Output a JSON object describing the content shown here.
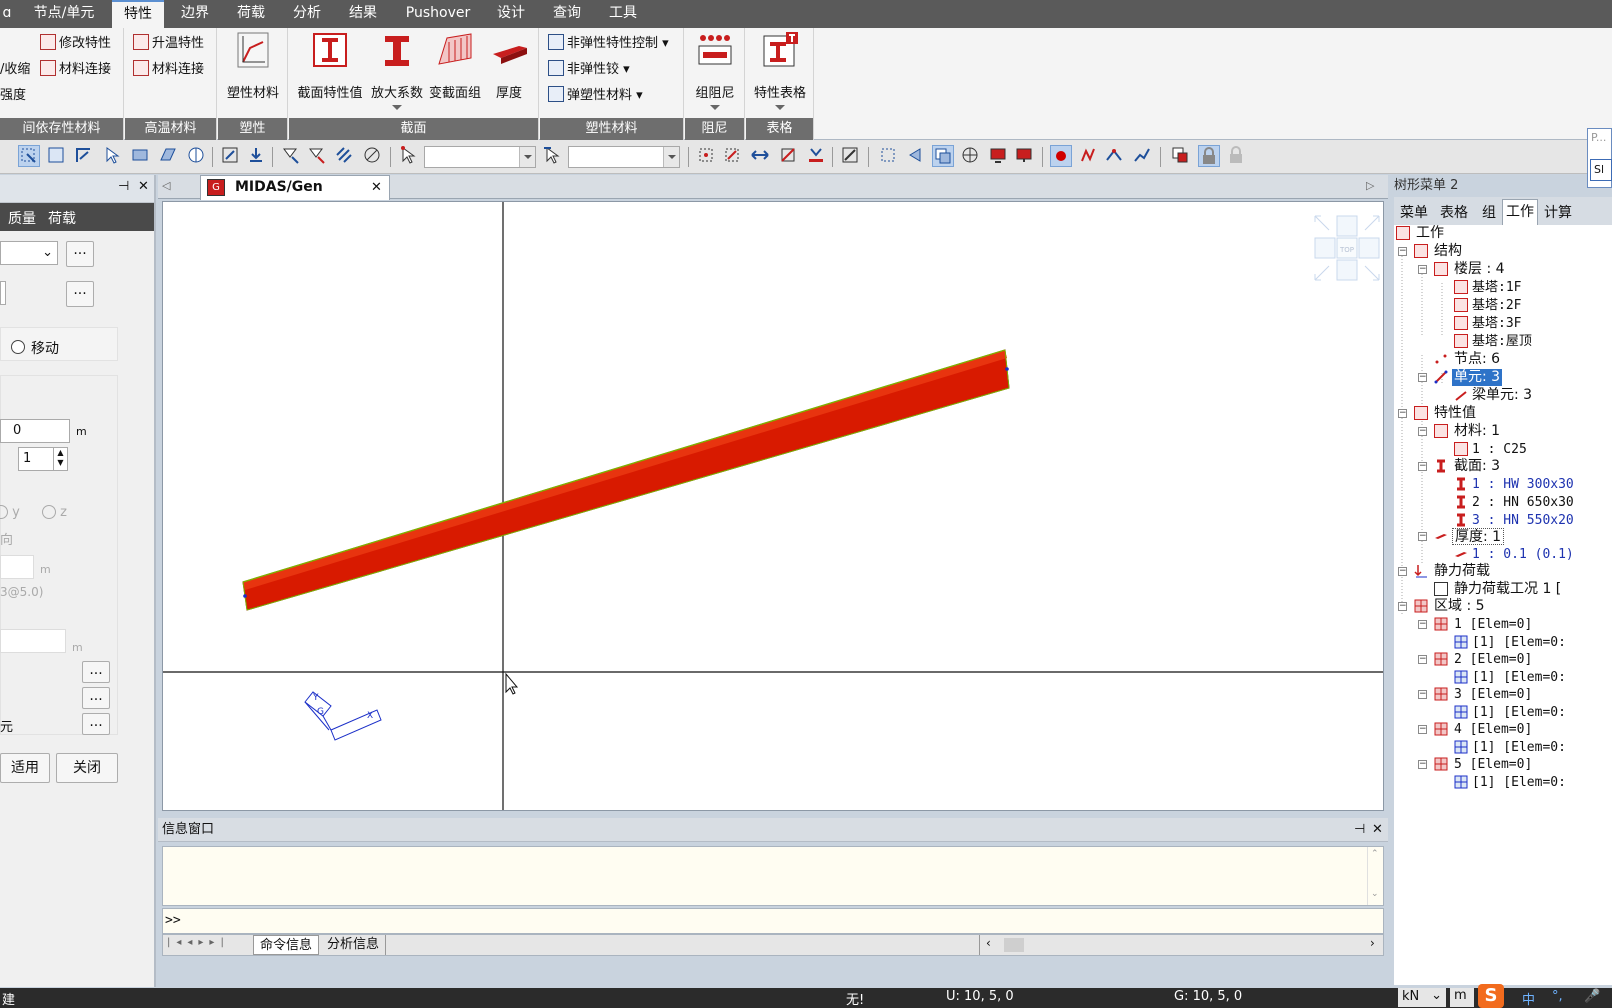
{
  "menu": {
    "tabs": [
      "节点/单元",
      "特性",
      "边界",
      "荷载",
      "分析",
      "结果",
      "Pushover",
      "设计",
      "查询",
      "工具"
    ],
    "active": "特性",
    "left_cut": "ɑ"
  },
  "ribbon": {
    "g1": {
      "title": "间依存性材料",
      "b1": "修改特性",
      "b2": "/收缩",
      "b3": "材料连接",
      "b4": "强度"
    },
    "g2": {
      "title": "高温材料",
      "b1": "升温特性",
      "b2": "材料连接"
    },
    "g3": {
      "title": "塑性",
      "b1": "塑性材料"
    },
    "g4": {
      "title": "截面",
      "b1": "截面特性值",
      "b2": "放大系数",
      "b3": "变截面组",
      "b4": "厚度"
    },
    "g5": {
      "title": "塑性材料",
      "b1": "非弹性特性控制",
      "b2": "非弹性铰",
      "b3": "弹塑性材料"
    },
    "g6": {
      "title": "阻尼",
      "b1": "组阻尼"
    },
    "g7": {
      "title": "表格",
      "b1": "特性表格"
    }
  },
  "left_panel": {
    "tab_quality": "质量",
    "tab_load": "荷载",
    "radio_move": "移动",
    "field_value": "0",
    "unit_m": "m",
    "spin_value": "1",
    "axis_y": "y",
    "axis_z": "z",
    "dir_label": "向",
    "coord_hint": "3@5.0)",
    "unit_m2": "m",
    "unit_m3": "m",
    "elem_label": "元",
    "ellipsis": "...",
    "apply": "适用",
    "close": "关闭",
    "pin": "⊣",
    "x": "✕"
  },
  "doc": {
    "tab_title": "MIDAS/Gen",
    "viewcube_label": "TOP"
  },
  "info": {
    "title": "信息窗口",
    "prompt": ">>",
    "tab_cmd": "命令信息",
    "tab_analysis": "分析信息"
  },
  "tree": {
    "header": "树形菜单 2",
    "tabs": [
      "菜单",
      "表格",
      "组",
      "工作",
      "计算"
    ],
    "active_tab": "工作",
    "nodes": [
      "工作",
      "结构",
      "楼层 : 4",
      "基塔:1F",
      "基塔:2F",
      "基塔:3F",
      "基塔:屋顶",
      "节点: 6",
      "单元: 3",
      "梁单元: 3",
      "特性值",
      "材料: 1",
      "1 : C25",
      "截面: 3",
      "1 : HW 300x30",
      "2 : HN 650x30",
      "3 : HN 550x20",
      "厚度: 1",
      "1 : 0.1 (0.1)",
      "静力荷载",
      "静力荷载工况 1 [",
      "区域 : 5",
      "1 [Elem=0]",
      "[1] [Elem=0:",
      "2 [Elem=0]",
      "[1] [Elem=0:",
      "3 [Elem=0]",
      "[1] [Elem=0:",
      "4 [Elem=0]",
      "[1] [Elem=0:",
      "5 [Elem=0]",
      "[1] [Elem=0:"
    ]
  },
  "status": {
    "left": "建",
    "none": "无!",
    "u": "U: 10, 5, 0",
    "g": "G: 10, 5, 0",
    "unit_force": "kN",
    "unit_len": "m",
    "ime_cn": "中",
    "ime_punc": "°,"
  },
  "search": {
    "placeholder": "P...",
    "btn": "Sl"
  },
  "colors": {
    "beam": "#d81a00",
    "beam_edge": "#7fb000",
    "accent": "#2e73c8"
  }
}
